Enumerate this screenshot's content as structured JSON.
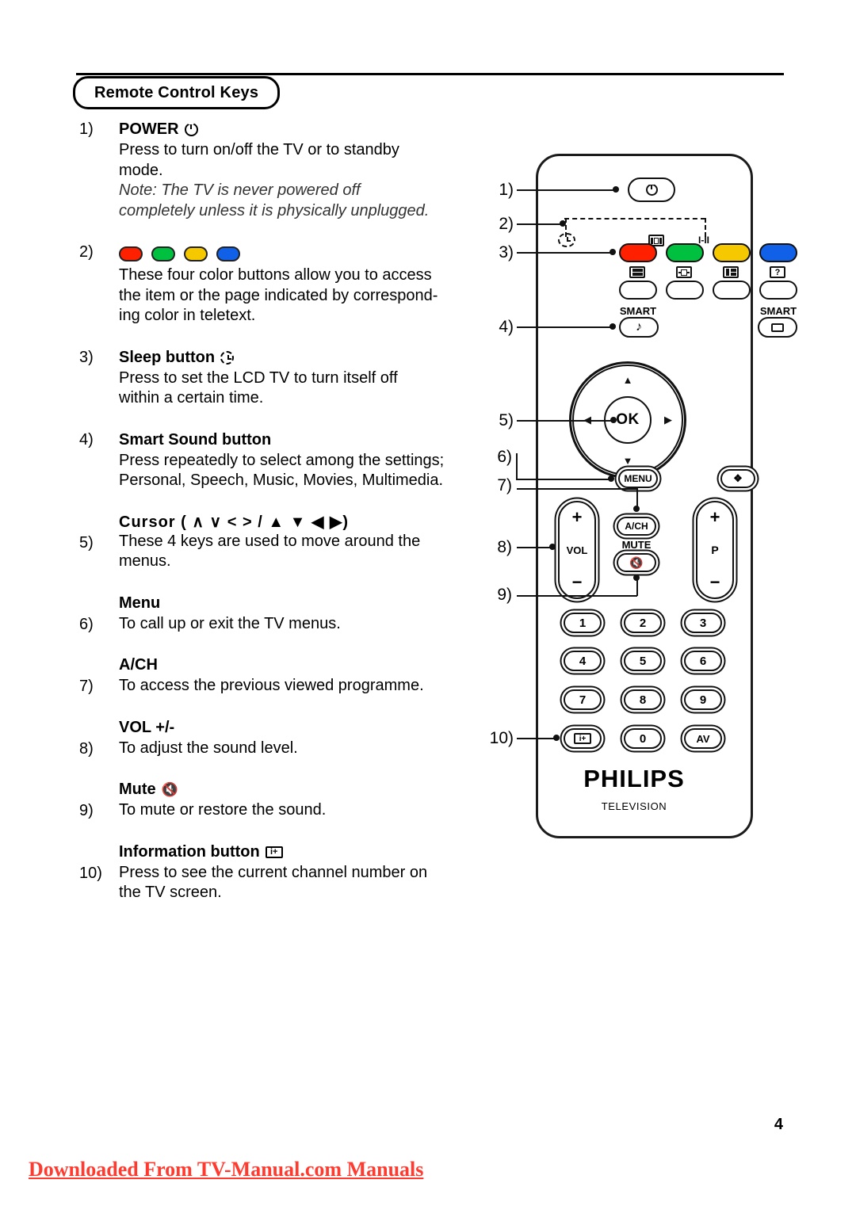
{
  "header": {
    "section_title": "Remote Control Keys"
  },
  "entries": [
    {
      "num": "1)",
      "title": "POWER",
      "icon": "power-icon",
      "lines": [
        "Press to turn on/off the TV or to standby",
        "mode."
      ],
      "note": [
        "Note: The TV is never powered off",
        "completely unless it is physically unplugged."
      ]
    },
    {
      "num": "2)",
      "title": "",
      "icon": "color-buttons",
      "lines": [
        "These four color buttons allow you to access",
        "the item or the page indicated by correspond-",
        "ing color in teletext."
      ],
      "note": []
    },
    {
      "num": "3)",
      "title": "Sleep button",
      "icon": "sleep-icon",
      "lines": [
        "Press to set the LCD TV to turn itself off",
        "within a certain time."
      ],
      "note": []
    },
    {
      "num": "4)",
      "title": "Smart Sound button",
      "icon": "",
      "lines": [
        "Press repeatedly to select among the settings;",
        "Personal, Speech, Music, Movies,  Multimedia."
      ],
      "note": []
    },
    {
      "num": "5)",
      "title": "Cursor",
      "title_suffix": "( ∧ ∨ < > / ▲  ▼  ◀  ▶)",
      "icon": "",
      "lines": [
        "These 4 keys are used to move around the",
        "menus."
      ],
      "note": []
    },
    {
      "num": "6)",
      "title": "Menu",
      "icon": "",
      "lines": [
        "To call up or exit the TV menus."
      ],
      "note": []
    },
    {
      "num": "7)",
      "title": "A/CH",
      "icon": "",
      "lines": [
        "To access the previous viewed programme."
      ],
      "note": []
    },
    {
      "num": "8)",
      "title": "VOL +/-",
      "icon": "",
      "lines": [
        "To adjust the sound level."
      ],
      "note": []
    },
    {
      "num": "9)",
      "title": "Mute",
      "icon": "mute-icon",
      "lines": [
        "To mute or restore the sound."
      ],
      "note": []
    },
    {
      "num": "10)",
      "title": "Information button",
      "icon": "information-icon",
      "lines": [
        "Press to see the current channel number on",
        "the TV screen."
      ],
      "note": []
    }
  ],
  "color_buttons": [
    {
      "name": "red",
      "hex": "#FF2000"
    },
    {
      "name": "green",
      "hex": "#00C040"
    },
    {
      "name": "yellow",
      "hex": "#F5C800"
    },
    {
      "name": "blue",
      "hex": "#1060E8"
    }
  ],
  "remote": {
    "callouts": [
      "1)",
      "2)",
      "3)",
      "4)",
      "5)",
      "6)",
      "7)",
      "8)",
      "9)",
      "10)"
    ],
    "power_label": "",
    "teletext_top_labels": [
      "sleep-icon",
      "",
      "wide-screen-icon",
      "I-II"
    ],
    "teletext_bottom_labels": [
      "teletext-index-icon",
      "subtitle-icon",
      "list-icon",
      "reveal-icon"
    ],
    "smart_left_label": "SMART",
    "smart_right_label": "SMART",
    "ok_label": "OK",
    "menu_label": "MENU",
    "ach_label": "A/CH",
    "mute_label": "MUTE",
    "vol_label": "VOL",
    "prog_label": "P",
    "plus": "+",
    "minus": "−",
    "keypad": [
      "1",
      "2",
      "3",
      "4",
      "5",
      "6",
      "7",
      "8",
      "9",
      "info-icon",
      "0",
      "AV"
    ],
    "brand": "PHILIPS",
    "sub_brand": "TELEVISION"
  },
  "footer": {
    "page_number": "4",
    "download_text": "Downloaded From TV-Manual.com Manuals",
    "download_color": "#ff3b30"
  }
}
